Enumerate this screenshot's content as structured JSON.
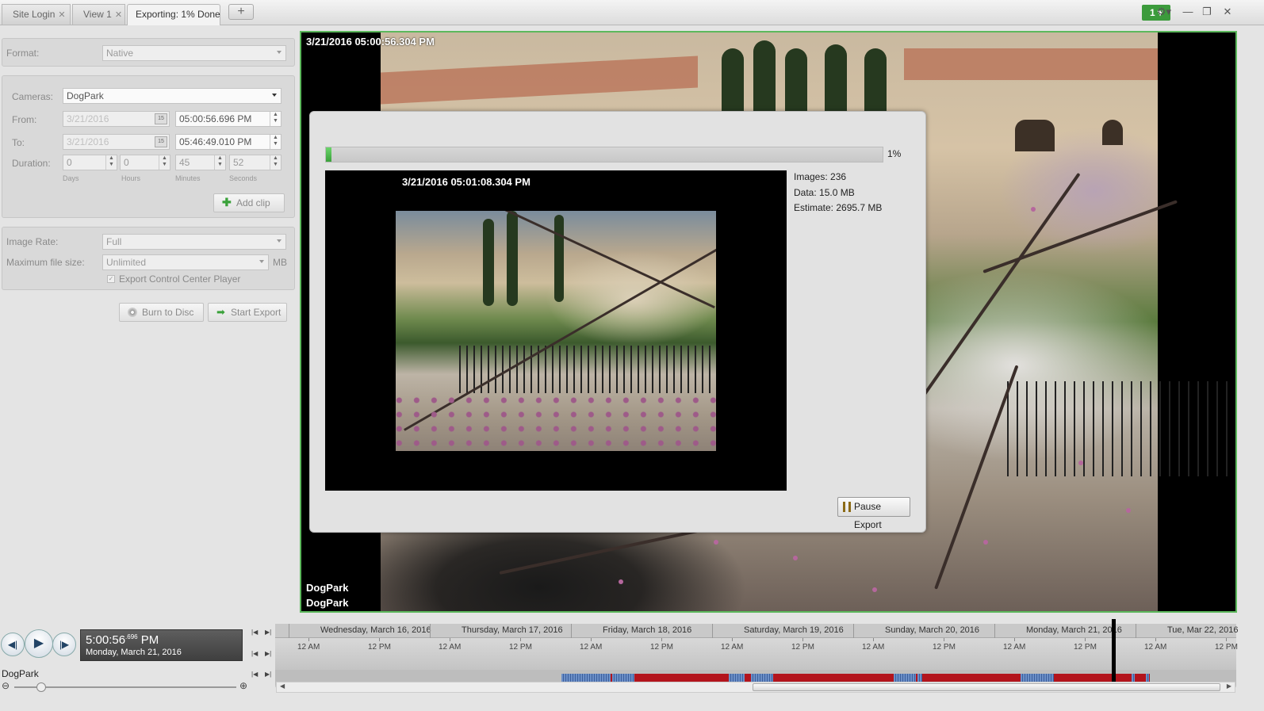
{
  "tabs": [
    {
      "label": "Site Login"
    },
    {
      "label": "View 1"
    },
    {
      "label": "Exporting: 1% Done"
    }
  ],
  "monitor_badge": "1",
  "icons": {
    "close": "close-icon",
    "add": "plus-icon",
    "gear": "gear-icon",
    "minimize": "minimize-icon",
    "restore": "restore-icon",
    "window_close": "window-close-icon"
  },
  "export": {
    "format_label": "Format:",
    "format_value": "Native",
    "cameras_label": "Cameras:",
    "cameras_value": "DogPark",
    "from_label": "From:",
    "from_date": "3/21/2016",
    "from_time": "05:00:56.696 PM",
    "to_label": "To:",
    "to_date": "3/21/2016",
    "to_time": "05:46:49.010 PM",
    "duration_label": "Duration:",
    "duration": {
      "days": "0",
      "hours": "0",
      "minutes": "45",
      "seconds": "52"
    },
    "duration_units": {
      "days": "Days",
      "hours": "Hours",
      "minutes": "Minutes",
      "seconds": "Seconds"
    },
    "cal_glyph": "15",
    "add_clip": "Add clip",
    "image_rate_label": "Image Rate:",
    "image_rate_value": "Full",
    "max_size_label": "Maximum file size:",
    "max_size_value": "Unlimited",
    "max_size_unit": "MB",
    "player_label": "Export Control Center Player",
    "burn_label": "Burn to Disc",
    "start_label": "Start Export"
  },
  "video": {
    "timestamp": "3/21/2016 05:00:56.304 PM",
    "camera_line1": "DogPark",
    "camera_line2": "DogPark"
  },
  "dialog": {
    "progress": 0.01,
    "progress_text": "1%",
    "preview_timestamp": "3/21/2016 05:01:08.304 PM",
    "images": "Images: 236",
    "data": "Data: 15.0 MB",
    "estimate": "Estimate: 2695.7 MB",
    "pause_label": "Pause Export"
  },
  "playback": {
    "time": "5:00:56",
    "ms": ".696",
    "period": "PM",
    "date": "Monday, March 21, 2016"
  },
  "timeline": {
    "camera": "DogPark",
    "days": [
      "Wednesday, March 16, 2016",
      "Thursday, March 17, 2016",
      "Friday, March 18, 2016",
      "Saturday, March 19, 2016",
      "Sunday, March 20, 2016",
      "Monday, March 21, 2016",
      "Tue, Mar 22, 2016"
    ],
    "hour_labels": [
      "12 AM",
      "12 PM",
      "12 AM",
      "12 PM",
      "12 AM",
      "12 PM",
      "12 AM",
      "12 PM",
      "12 AM",
      "12 PM",
      "12 AM",
      "12 PM",
      "12 AM",
      "12 PM"
    ],
    "recording_color": "#b3141c",
    "motion_color": "#6b8fc7"
  }
}
